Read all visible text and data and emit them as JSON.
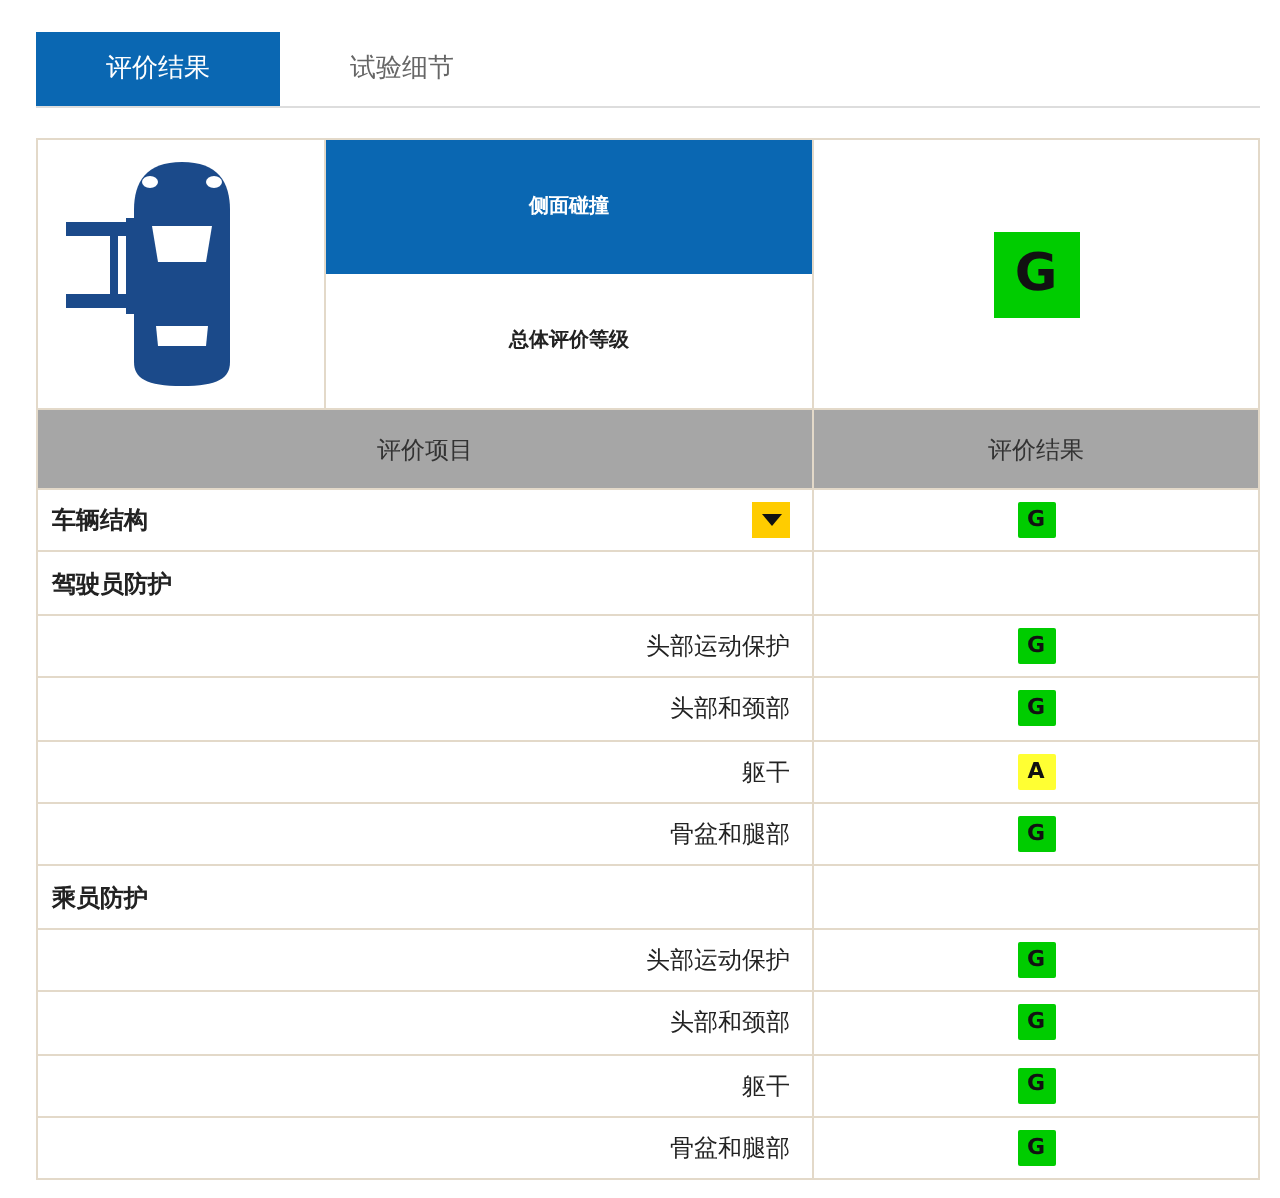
{
  "tabs": [
    {
      "label": "评价结果",
      "selected": true
    },
    {
      "label": "试验细节",
      "selected": false
    }
  ],
  "summary": {
    "test_name": "侧面碰撞",
    "label": "总体评价等级",
    "grade": "G"
  },
  "table": {
    "columns": [
      "评价项目",
      "评价结果"
    ],
    "rows": [
      {
        "kind": "section",
        "label": "车辆结构",
        "grade": "G",
        "toggle": true
      },
      {
        "kind": "section",
        "label": "驾驶员防护"
      },
      {
        "kind": "item",
        "label": "头部运动保护",
        "grade": "G"
      },
      {
        "kind": "item",
        "label": "头部和颈部",
        "grade": "G"
      },
      {
        "kind": "item",
        "label": "躯干",
        "grade": "A"
      },
      {
        "kind": "item",
        "label": "骨盆和腿部",
        "grade": "G"
      },
      {
        "kind": "section",
        "label": "乘员防护"
      },
      {
        "kind": "item",
        "label": "头部运动保护",
        "grade": "G"
      },
      {
        "kind": "item",
        "label": "头部和颈部",
        "grade": "G"
      },
      {
        "kind": "item",
        "label": "躯干",
        "grade": "G"
      },
      {
        "kind": "item",
        "label": "骨盆和腿部",
        "grade": "G"
      }
    ]
  }
}
